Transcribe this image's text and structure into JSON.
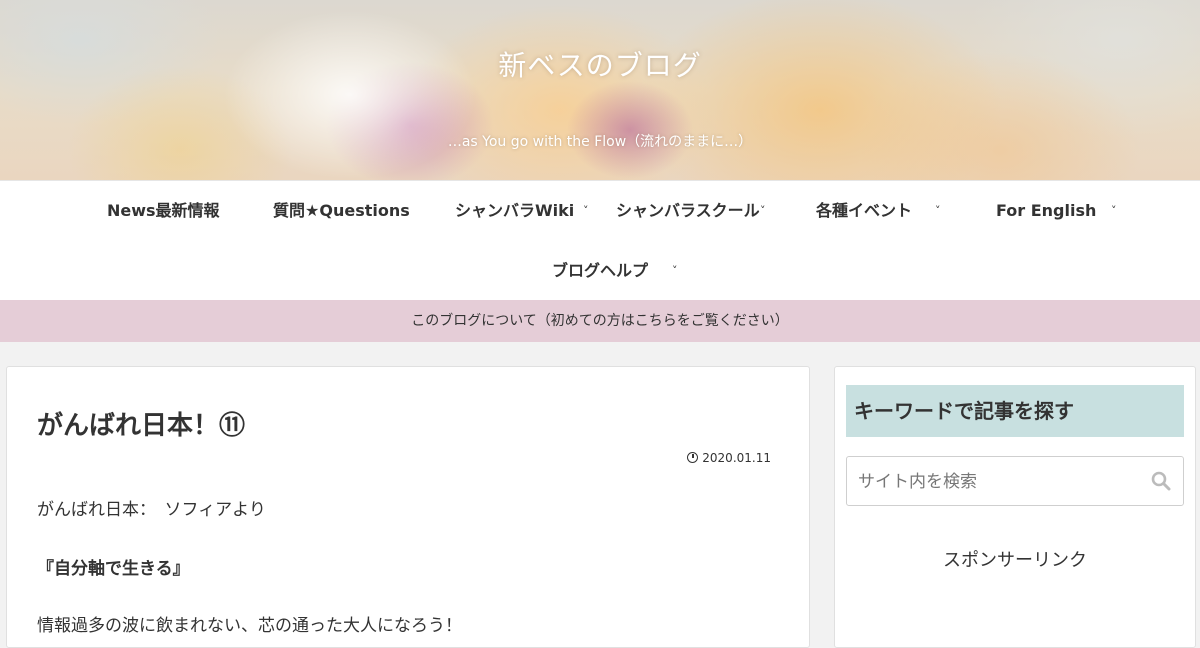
{
  "header": {
    "site_title": "新ベスのブログ",
    "tagline": "…as You go with the Flow（流れのままに…）"
  },
  "nav": {
    "items": [
      {
        "label": "News最新情報",
        "has_dropdown": false
      },
      {
        "label": "質問★Questions",
        "has_dropdown": false
      },
      {
        "label": "シャンバラWiki",
        "has_dropdown": true
      },
      {
        "label": "シャンバラスクール",
        "has_dropdown": true
      },
      {
        "label": "各種イベント",
        "has_dropdown": true
      },
      {
        "label": "For English",
        "has_dropdown": true
      },
      {
        "label": "ブログヘルプ",
        "has_dropdown": true
      }
    ],
    "chevron": "˅"
  },
  "notice": {
    "text": "このブログについて（初めての方はこちらをご覧ください）"
  },
  "article": {
    "title": "がんばれ日本！⑪",
    "date": "2020.01.11",
    "paragraphs": [
      "がんばれ日本：　ソフィアより",
      "『自分軸で生きる』",
      "情報過多の波に飲まれない、芯の通った大人になろう！"
    ]
  },
  "sidebar": {
    "widget_title": "キーワードで記事を探す",
    "search_placeholder": "サイト内を検索",
    "sponsor_label": "スポンサーリンク"
  },
  "colors": {
    "notice_bg": "#e5cdd7",
    "widget_title_bg": "#c8e0e0",
    "page_bg": "#f2f2f2"
  }
}
